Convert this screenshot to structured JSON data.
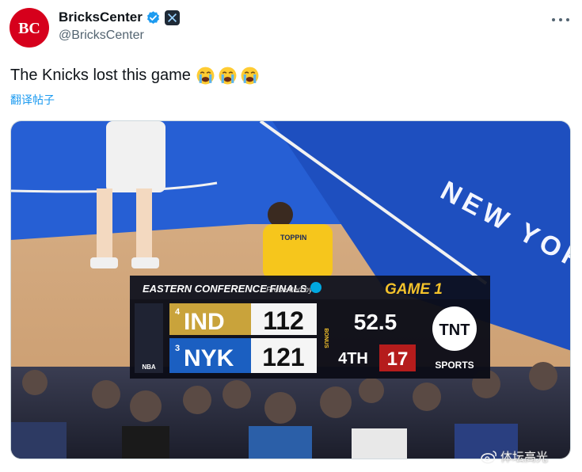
{
  "tweet": {
    "display_name": "BricksCenter",
    "handle": "@BricksCenter",
    "avatar_text": "BC",
    "text": "The Knicks lost this game",
    "translate_label": "翻译帖子",
    "emojis": [
      "loudly-crying-face",
      "loudly-crying-face",
      "loudly-crying-face"
    ]
  },
  "icons": {
    "verified": "verified-badge-icon",
    "x_badge": "x-logo-icon",
    "more": "more-options-icon"
  },
  "scoreboard": {
    "series_label": "EASTERN CONFERENCE FINALS",
    "presented_by": "Presented by",
    "game_label": "GAME 1",
    "bonus_label": "BONUS",
    "teams": [
      {
        "seed": "4",
        "abbr": "IND",
        "score": "112"
      },
      {
        "seed": "3",
        "abbr": "NYK",
        "score": "121"
      }
    ],
    "game_clock": "52.5",
    "quarter": "4TH",
    "shot_clock": "17",
    "network_logo": "TNT",
    "network_sub": "SPORTS",
    "league_logo": "NBA"
  },
  "court": {
    "wordmark": "NEW YORK",
    "jersey_text": "TOPPIN"
  },
  "watermark": {
    "text": "体坛高光"
  },
  "colors": {
    "brand_red": "#d6001c",
    "verified_blue": "#1d9bf0",
    "link_blue": "#1d9bf0",
    "ind_gold": "#f3c22b",
    "nyk_blue": "#1b5fc1",
    "shot_clock_red": "#b51c1c",
    "court_blue": "#1c5bd8"
  }
}
